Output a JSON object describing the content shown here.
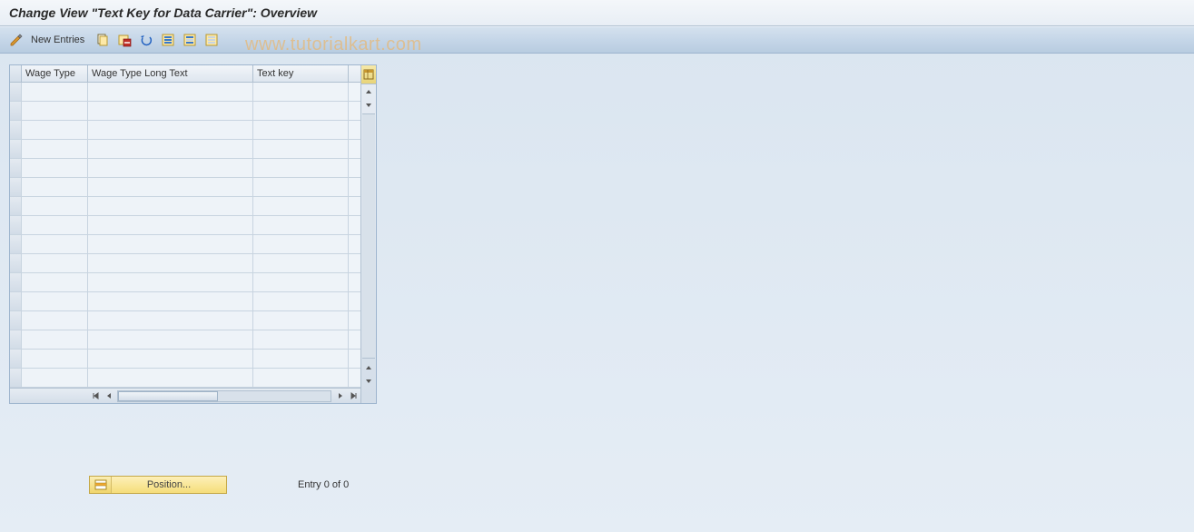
{
  "title": "Change View \"Text Key for Data Carrier\": Overview",
  "watermark": "www.tutorialkart.com",
  "toolbar": {
    "new_entries_label": "New Entries"
  },
  "table": {
    "columns": [
      "Wage Type",
      "Wage Type Long Text",
      "Text key"
    ],
    "rows": [
      {
        "wage_type": "",
        "long_text": "",
        "text_key": ""
      },
      {
        "wage_type": "",
        "long_text": "",
        "text_key": ""
      },
      {
        "wage_type": "",
        "long_text": "",
        "text_key": ""
      },
      {
        "wage_type": "",
        "long_text": "",
        "text_key": ""
      },
      {
        "wage_type": "",
        "long_text": "",
        "text_key": ""
      },
      {
        "wage_type": "",
        "long_text": "",
        "text_key": ""
      },
      {
        "wage_type": "",
        "long_text": "",
        "text_key": ""
      },
      {
        "wage_type": "",
        "long_text": "",
        "text_key": ""
      },
      {
        "wage_type": "",
        "long_text": "",
        "text_key": ""
      },
      {
        "wage_type": "",
        "long_text": "",
        "text_key": ""
      },
      {
        "wage_type": "",
        "long_text": "",
        "text_key": ""
      },
      {
        "wage_type": "",
        "long_text": "",
        "text_key": ""
      },
      {
        "wage_type": "",
        "long_text": "",
        "text_key": ""
      },
      {
        "wage_type": "",
        "long_text": "",
        "text_key": ""
      },
      {
        "wage_type": "",
        "long_text": "",
        "text_key": ""
      },
      {
        "wage_type": "",
        "long_text": "",
        "text_key": ""
      }
    ]
  },
  "footer": {
    "position_label": "Position...",
    "entry_text": "Entry 0 of 0"
  }
}
